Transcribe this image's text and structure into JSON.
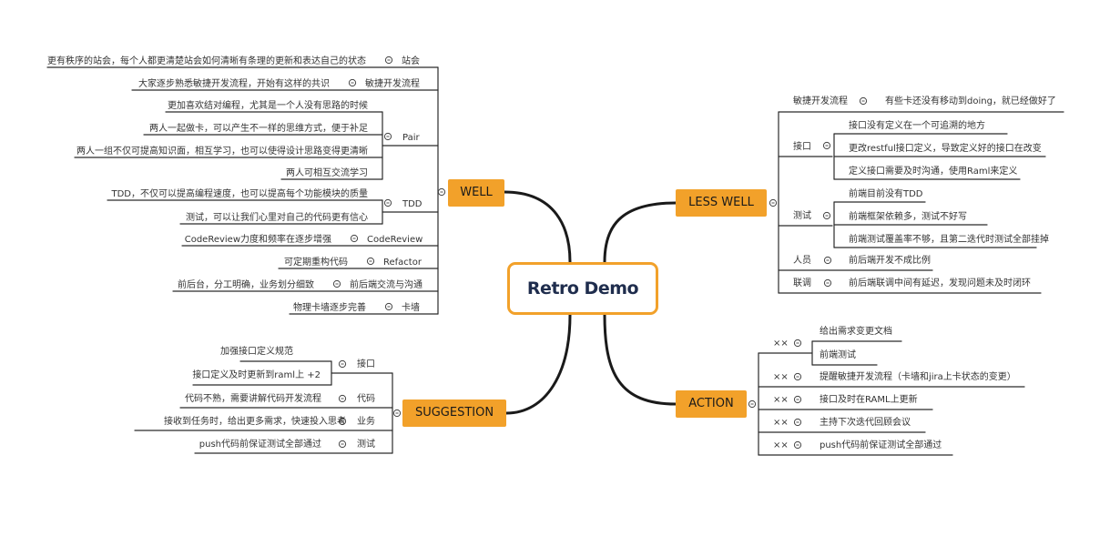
{
  "root": {
    "title": "Retro Demo"
  },
  "well": {
    "label": "WELL",
    "items": [
      {
        "topic": "站会",
        "details": [
          "更有秩序的站会，每个人都更清楚站会如何清晰有条理的更新和表达自己的状态"
        ]
      },
      {
        "topic": "敏捷开发流程",
        "details": [
          "大家逐步熟悉敏捷开发流程，开始有这样的共识"
        ]
      },
      {
        "topic": "Pair",
        "details": [
          "更加喜欢结对编程，尤其是一个人没有思路的时候",
          "两人一起做卡，可以产生不一样的思维方式，便于补足",
          "两人一组不仅可提高知识面，相互学习，也可以使得设计思路变得更清晰",
          "两人可相互交流学习"
        ]
      },
      {
        "topic": "TDD",
        "details": [
          "TDD，不仅可以提高编程速度，也可以提高每个功能模块的质量",
          "测试，可以让我们心里对自己的代码更有信心"
        ]
      },
      {
        "topic": "CodeReview",
        "details": [
          "CodeReview力度和频率在逐步增强"
        ]
      },
      {
        "topic": "Refactor",
        "details": [
          "可定期重构代码"
        ]
      },
      {
        "topic": "前后端交流与沟通",
        "details": [
          "前后台，分工明确，业务划分细致"
        ]
      },
      {
        "topic": "卡墙",
        "details": [
          "物理卡墙逐步完善"
        ]
      }
    ]
  },
  "less_well": {
    "label": "LESS WELL",
    "items": [
      {
        "topic": "敏捷开发流程",
        "details": [
          "有些卡还没有移动到doing，就已经做好了"
        ]
      },
      {
        "topic": "接口",
        "details": [
          "接口没有定义在一个可追溯的地方",
          "更改restful接口定义，导致定义好的接口在改变",
          "定义接口需要及时沟通，使用Raml来定义"
        ]
      },
      {
        "topic": "测试",
        "details": [
          "前端目前没有TDD",
          "前端框架依赖多，测试不好写",
          "前端测试覆盖率不够，且第二迭代时测试全部挂掉"
        ]
      },
      {
        "topic": "人员",
        "details": [
          "前后端开发不成比例"
        ]
      },
      {
        "topic": "联调",
        "details": [
          "前后端联调中间有延迟，发现问题未及时闭环"
        ]
      }
    ]
  },
  "suggestion": {
    "label": "SUGGESTION",
    "items": [
      {
        "topic": "接口",
        "details": [
          "加强接口定义规范",
          "接口定义及时更新到raml上 +2"
        ]
      },
      {
        "topic": "代码",
        "details": [
          "代码不熟，需要讲解代码开发流程"
        ]
      },
      {
        "topic": "业务",
        "details": [
          "接收到任务时，给出更多需求，快速投入思考"
        ]
      },
      {
        "topic": "测试",
        "details": [
          "push代码前保证测试全部通过"
        ]
      }
    ]
  },
  "action": {
    "label": "ACTION",
    "owner_mark": "××",
    "items": [
      {
        "details": [
          "给出需求变更文档",
          "前端测试"
        ]
      },
      {
        "details": [
          "提醒敏捷开发流程（卡墙和jira上卡状态的变更）"
        ]
      },
      {
        "details": [
          "接口及时在RAML上更新"
        ]
      },
      {
        "details": [
          "主持下次迭代回顾会议"
        ]
      },
      {
        "details": [
          "push代码前保证测试全部通过"
        ]
      }
    ]
  },
  "colors": {
    "accent": "#f2a12a",
    "line": "#2b2b2b",
    "root_text": "#1f2d4d"
  },
  "icons": {
    "collapse": "circle-minus-icon"
  }
}
